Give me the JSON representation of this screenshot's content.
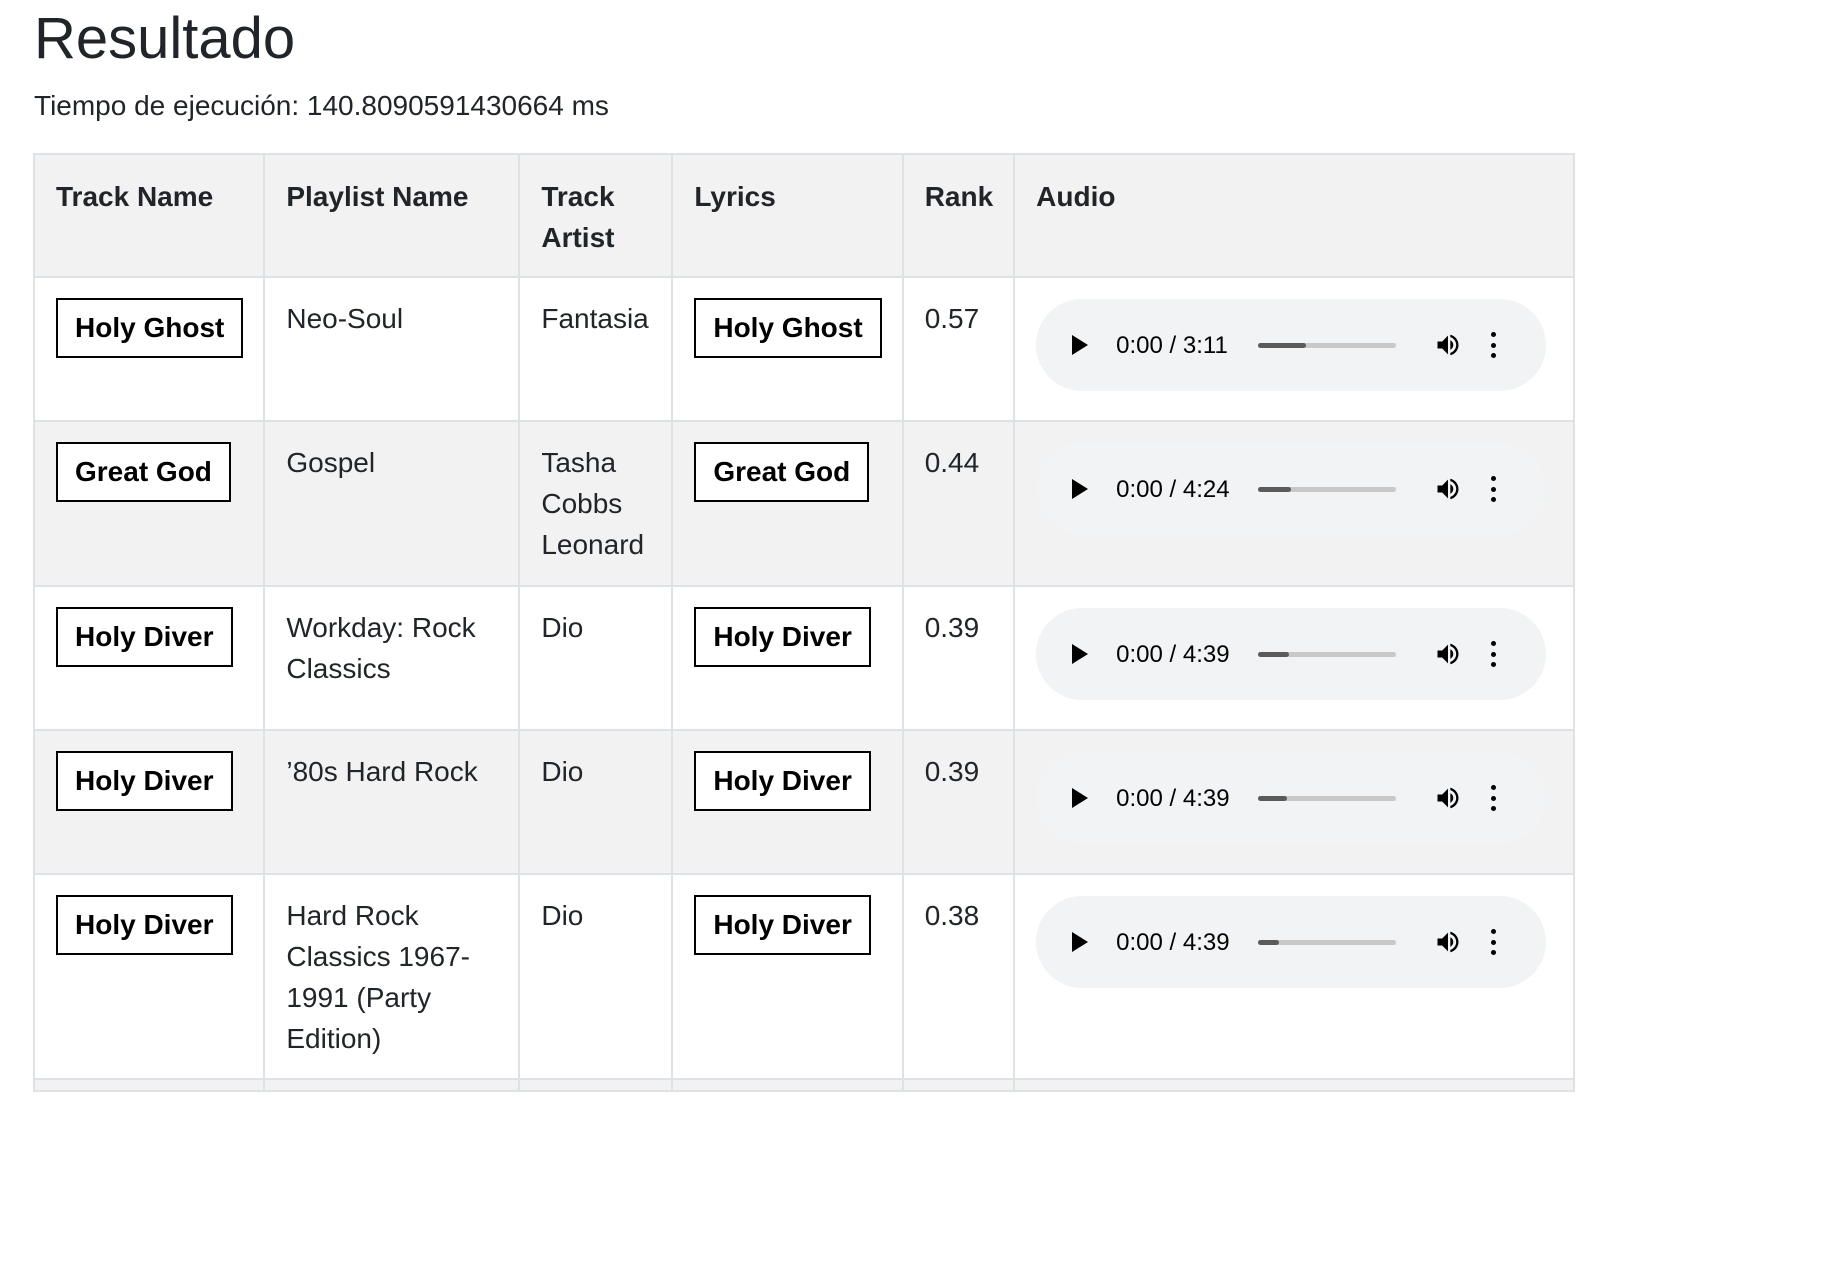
{
  "page": {
    "title": "Resultado",
    "exec_time": "Tiempo de ejecución: 140.8090591430664 ms"
  },
  "table": {
    "headers": [
      "Track Name",
      "Playlist Name",
      "Track Artist",
      "Lyrics",
      "Rank",
      "Audio"
    ],
    "rows": [
      {
        "track": "Holy Ghost",
        "playlist": "Neo-Soul",
        "artist": "Fantasia",
        "lyrics": "Holy Ghost",
        "rank": "0.57",
        "time": "0:00 / 3:11",
        "buffered": 0.35
      },
      {
        "track": "Great God",
        "playlist": "Gospel",
        "artist": "Tasha Cobbs Leonard",
        "lyrics": "Great God",
        "rank": "0.44",
        "time": "0:00 / 4:24",
        "buffered": 0.24
      },
      {
        "track": "Holy Diver",
        "playlist": "Workday: Rock Classics",
        "artist": "Dio",
        "lyrics": "Holy Diver",
        "rank": "0.39",
        "time": "0:00 / 4:39",
        "buffered": 0.22
      },
      {
        "track": "Holy Diver",
        "playlist": "’80s Hard Rock",
        "artist": "Dio",
        "lyrics": "Holy Diver",
        "rank": "0.39",
        "time": "0:00 / 4:39",
        "buffered": 0.21
      },
      {
        "track": "Holy Diver",
        "playlist": "Hard Rock Classics 1967-1991 (Party Edition)",
        "artist": "Dio",
        "lyrics": "Holy Diver",
        "rank": "0.38",
        "time": "0:00 / 4:39",
        "buffered": 0.15
      }
    ]
  },
  "icons": {
    "play": "play-icon",
    "volume": "volume-icon",
    "more": "more-vertical-icon"
  }
}
